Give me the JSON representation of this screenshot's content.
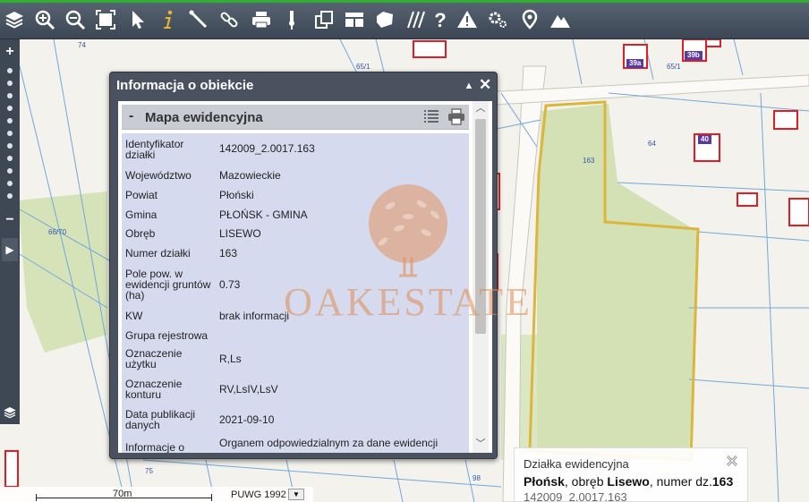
{
  "toolbar": {
    "tools": [
      {
        "icon": "layers-icon"
      },
      {
        "icon": "zoom-in-icon"
      },
      {
        "icon": "zoom-out-icon"
      },
      {
        "icon": "zoom-extent-icon"
      },
      {
        "icon": "pointer-icon"
      },
      {
        "icon": "info-icon"
      },
      {
        "icon": "measure-icon"
      },
      {
        "icon": "link-icon"
      },
      {
        "icon": "print-icon"
      },
      {
        "icon": "pin-icon"
      },
      {
        "icon": "copy-icon"
      },
      {
        "icon": "layout-icon"
      },
      {
        "icon": "shape-icon"
      },
      {
        "icon": "hatch-icon"
      },
      {
        "icon": "help-icon"
      },
      {
        "icon": "warning-icon"
      },
      {
        "icon": "settings-icon"
      },
      {
        "icon": "location-icon"
      },
      {
        "icon": "terrain-icon"
      }
    ]
  },
  "map": {
    "labels": {
      "l74": "74",
      "l651": "65/1",
      "l39a": "39a",
      "l651b": "65/1",
      "l39b": "39b",
      "l163": "163",
      "l64": "64",
      "l40": "40",
      "l6670": "66/70",
      "l75": "75",
      "l98": "98"
    }
  },
  "info_window": {
    "title": "Informacja o obiekcie",
    "minimize_glyph": "▲",
    "close_glyph": "✕",
    "section": {
      "toggle": "-",
      "title": "Mapa ewidencyjna"
    },
    "attributes": [
      {
        "key": "Identyfikator działki",
        "value": "142009_2.0017.163"
      },
      {
        "key": "Województwo",
        "value": "Mazowieckie"
      },
      {
        "key": "Powiat",
        "value": "Płoński"
      },
      {
        "key": "Gmina",
        "value": "PŁOŃSK - GMINA"
      },
      {
        "key": "Obręb",
        "value": "LISEWO"
      },
      {
        "key": "Numer działki",
        "value": "163"
      },
      {
        "key": "Pole pow. w ewidencji gruntów (ha)",
        "value": "0.73"
      },
      {
        "key": "KW",
        "value": "brak informacji"
      },
      {
        "key": "Grupa rejestrowa",
        "value": ""
      },
      {
        "key": "Oznaczenie użytku",
        "value": "R,Ls"
      },
      {
        "key": "Oznaczenie konturu",
        "value": "RV,LsIV,LsV"
      },
      {
        "key": "Data publikacji danych",
        "value": "2021-09-10"
      },
      {
        "key": "Informacje o",
        "value": "Organem odpowiedzialnym za dane ewidencji"
      }
    ]
  },
  "watermark": {
    "text": "OAKESTATE"
  },
  "popup": {
    "heading": "Działka ewidencyjna",
    "town": "Płońsk",
    "sep1": ", obręb ",
    "district": "Lisewo",
    "sep2": ", numer dz.",
    "number": "163",
    "id": "142009_2.0017.163"
  },
  "scale": {
    "label": "70m",
    "crs": "PUWG 1992",
    "crs_dropdown_glyph": "▼"
  },
  "colors": {
    "toolbar": "#4a5563",
    "parcel_outline": "#e0b830",
    "building_outline": "#e21c24",
    "field_green": "#d3e1b5",
    "panel_bg": "#d6daee"
  }
}
